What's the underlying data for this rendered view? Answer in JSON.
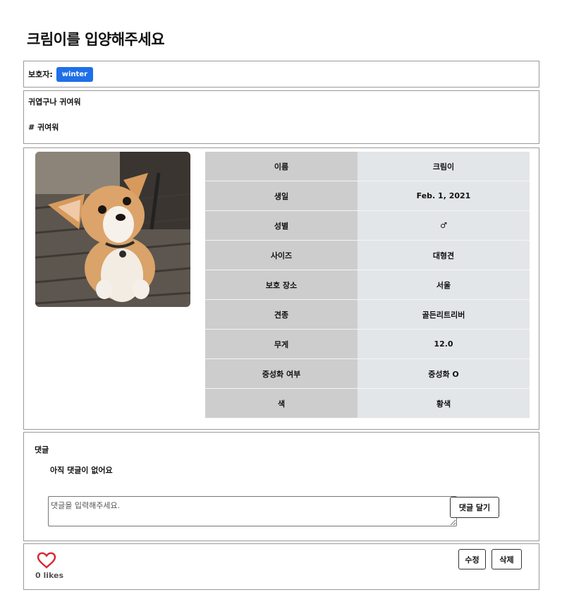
{
  "page": {
    "title": "크림이를 입양해주세요"
  },
  "guardian": {
    "label": "보호자:",
    "name": "winter",
    "badge_color": "#1f6fe8"
  },
  "description": {
    "text": "귀엽구나 귀여워",
    "tag": "# 귀여워"
  },
  "photo": {
    "subject": "corgi puppy photo"
  },
  "pet_info": [
    {
      "key": "이름",
      "value": "크림이"
    },
    {
      "key": "생일",
      "value": "Feb. 1, 2021"
    },
    {
      "key": "성별",
      "value": "♂"
    },
    {
      "key": "사이즈",
      "value": "대형견"
    },
    {
      "key": "보호 장소",
      "value": "서울"
    },
    {
      "key": "견종",
      "value": "골든리트리버"
    },
    {
      "key": "무게",
      "value": "12.0"
    },
    {
      "key": "중성화 여부",
      "value": "중성화 O"
    },
    {
      "key": "색",
      "value": "황색"
    }
  ],
  "comments": {
    "title": "댓글",
    "empty_text": "아직 댓글이 없어요",
    "input_placeholder": "댓글을 입력해주세요.",
    "submit_label": "댓글 달기"
  },
  "footer": {
    "likes_text": "0 likes",
    "like_icon": "heart-outline-icon",
    "like_color": "#d9252f",
    "edit_label": "수정",
    "delete_label": "삭제"
  }
}
